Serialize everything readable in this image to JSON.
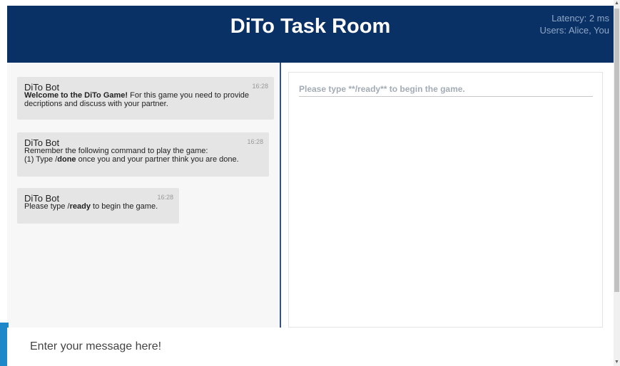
{
  "header": {
    "title": "DiTo Task Room",
    "latency": "Latency: 2 ms",
    "users": "Users: Alice, You"
  },
  "chat": {
    "messages": [
      {
        "author": "DiTo Bot",
        "time": "16:28",
        "bold_text": "Welcome to the DiTo Game!",
        "text": " For this game you need to provide decriptions and discuss with your partner."
      },
      {
        "author": "DiTo Bot",
        "time": "16:28",
        "line1": "Remember the following command to play the game:",
        "line2_pre": "(1) Type /",
        "line2_bold": "done",
        "line2_post": " once you and your partner think you are done."
      },
      {
        "author": "DiTo Bot",
        "time": "16:28",
        "pre": "Please type /",
        "bold": "ready",
        "post": " to begin the game."
      }
    ]
  },
  "task": {
    "prompt": "Please type **/ready** to begin the game."
  },
  "input": {
    "placeholder": "Enter your message here!"
  },
  "scrollbar": {
    "up_icon": "▲",
    "down_icon": "▼"
  },
  "colors": {
    "header_bg": "#0a3166",
    "divider": "#33528a",
    "accent": "#1e88c8"
  }
}
